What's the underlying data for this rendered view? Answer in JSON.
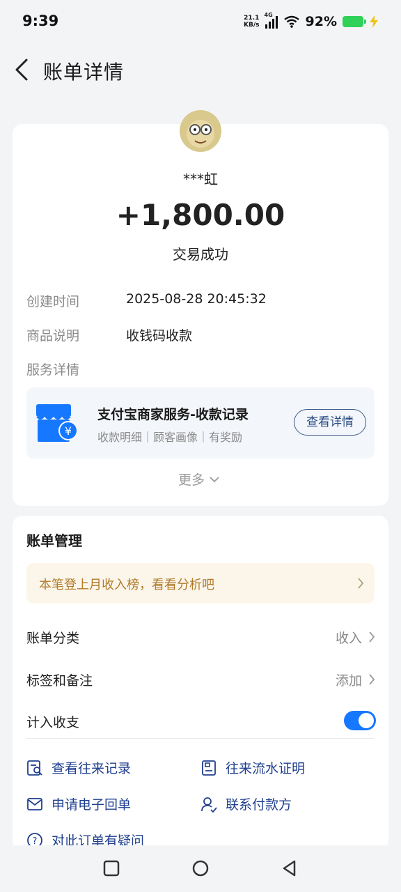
{
  "status_bar": {
    "time": "9:39",
    "net_speed_value": "21.1",
    "net_speed_unit": "KB/s",
    "network": "4G",
    "battery": "92%"
  },
  "header": {
    "title": "账单详情"
  },
  "transaction": {
    "payer": "***虹",
    "amount": "+1,800.00",
    "status": "交易成功",
    "rows": [
      {
        "label": "创建时间",
        "value": "2025-08-28 20:45:32"
      },
      {
        "label": "商品说明",
        "value": "收钱码收款"
      }
    ],
    "service_label": "服务详情",
    "service": {
      "title": "支付宝商家服务-收款记录",
      "subtitle": "收款明细｜顾客画像｜有奖励",
      "button": "查看详情"
    },
    "more": "更多"
  },
  "management": {
    "title": "账单管理",
    "banner": "本笔登上月收入榜，看看分析吧",
    "category_label": "账单分类",
    "category_value": "收入",
    "tags_label": "标签和备注",
    "tags_value": "添加",
    "include_label": "计入收支",
    "include_enabled": true,
    "actions": [
      {
        "label": "查看往来记录",
        "icon": "record-search-icon"
      },
      {
        "label": "往来流水证明",
        "icon": "document-icon"
      },
      {
        "label": "申请电子回单",
        "icon": "mail-icon"
      },
      {
        "label": "联系付款方",
        "icon": "contact-person-icon"
      },
      {
        "label": "对此订单有疑问",
        "icon": "question-icon"
      }
    ]
  },
  "colors": {
    "accent": "#1677ff",
    "banner_text": "#b07a2a",
    "link": "#1f3f8f"
  }
}
